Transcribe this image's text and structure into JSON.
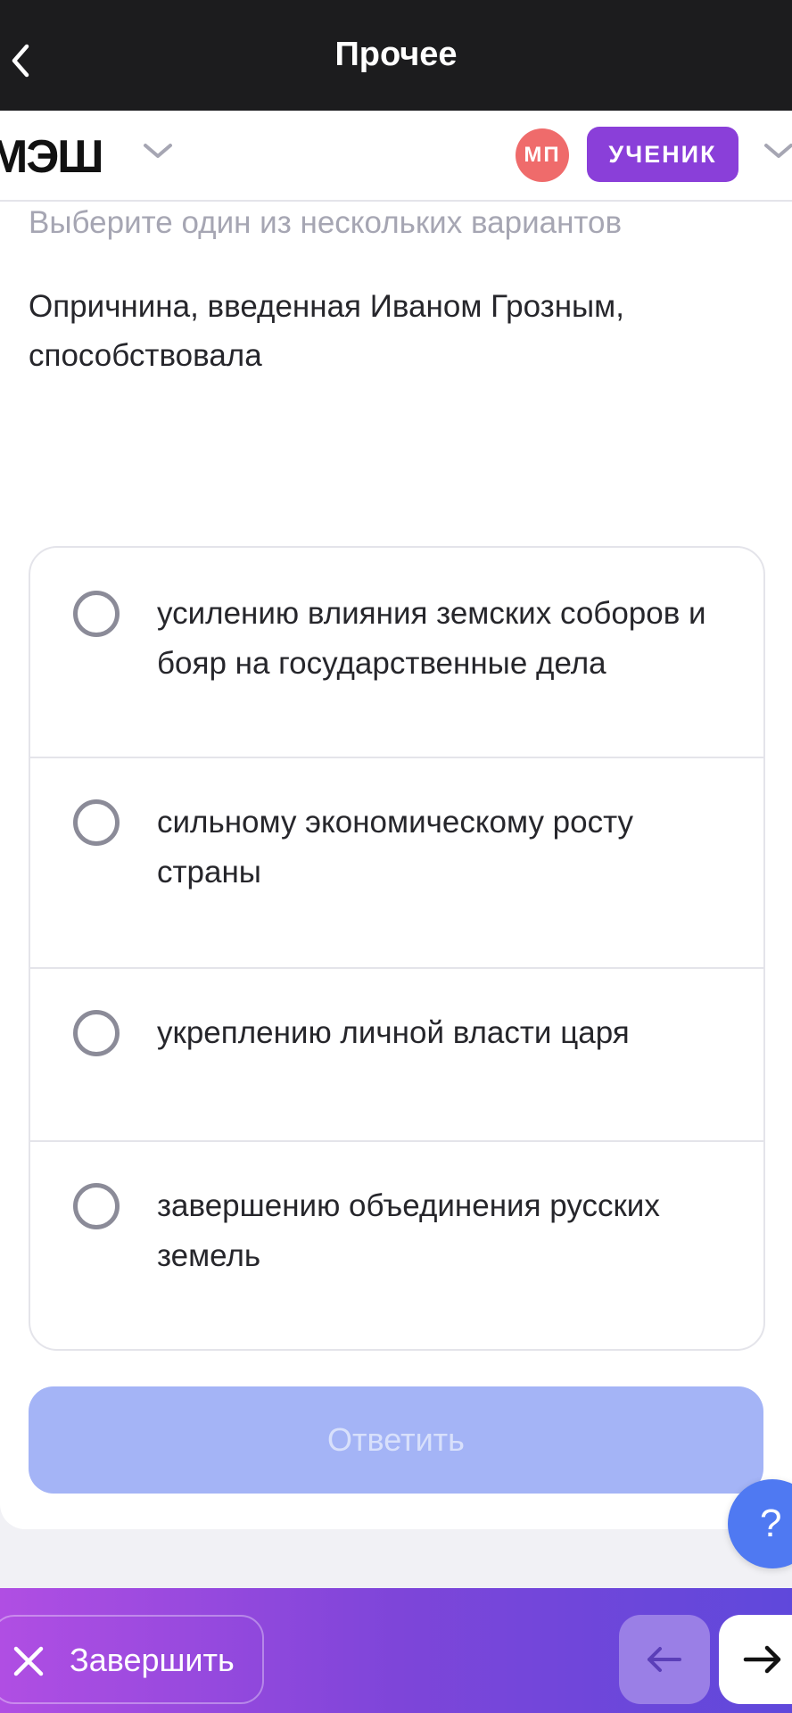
{
  "topbar": {
    "title": "Прочее",
    "back_icon": "chevron-left-icon"
  },
  "appbar": {
    "logo_text": "МЭШ",
    "avatar_initials": "МП",
    "role_label": "УЧЕНИК"
  },
  "task": {
    "hint": "Выберите один из нескольких вариантов",
    "question": "Опричнина, введенная Иваном Грозным, способствовала",
    "options": [
      "усилению влияния земских соборов и бояр на государственные дела",
      "сильному экономическому росту страны",
      "укреплению личной власти царя",
      "завершению объединения русских земель"
    ],
    "submit_label": "Ответить"
  },
  "help": {
    "label": "?"
  },
  "bottombar": {
    "finish_label": "Завершить"
  },
  "colors": {
    "topbar_bg": "#1c1c1e",
    "role_badge": "#8a3fd9",
    "avatar": "#ef6b6b",
    "submit_disabled": "#a4b4f6",
    "help_button": "#4f79f2",
    "bottombar_gradient_start": "#b04ee3",
    "bottombar_gradient_end": "#5f48db"
  }
}
